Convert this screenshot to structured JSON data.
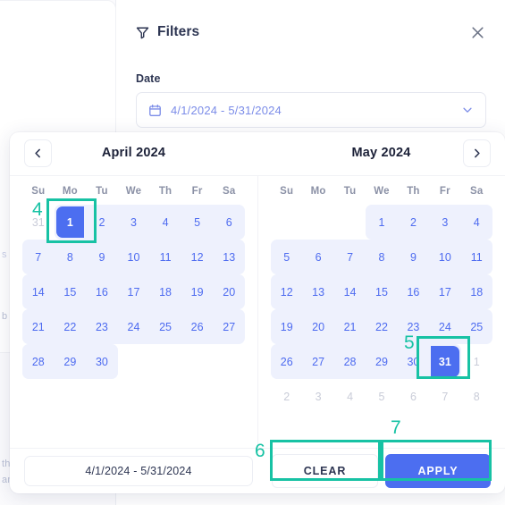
{
  "background": {
    "fragments": [
      "s",
      "b",
      "th",
      "an"
    ]
  },
  "filters": {
    "title": "Filters",
    "filter_icon": "funnel-icon",
    "close_icon": "close-icon"
  },
  "date_field": {
    "label": "Date",
    "value": "4/1/2024 - 5/31/2024",
    "calendar_icon": "calendar-icon",
    "chevron_icon": "chevron-down-icon"
  },
  "calendar": {
    "prev_icon": "chevron-left-icon",
    "next_icon": "chevron-right-icon",
    "weekdays": [
      "Su",
      "Mo",
      "Tu",
      "We",
      "Th",
      "Fr",
      "Sa"
    ],
    "months": [
      {
        "title": "April 2024",
        "weeks": [
          [
            {
              "d": "31",
              "state": "muted"
            },
            {
              "d": "1",
              "state": "selected-start"
            },
            {
              "d": "2",
              "state": "in-range"
            },
            {
              "d": "3",
              "state": "in-range"
            },
            {
              "d": "4",
              "state": "in-range"
            },
            {
              "d": "5",
              "state": "in-range"
            },
            {
              "d": "6",
              "state": "in-range-end"
            }
          ],
          [
            {
              "d": "7",
              "state": "in-range-start"
            },
            {
              "d": "8",
              "state": "in-range"
            },
            {
              "d": "9",
              "state": "in-range"
            },
            {
              "d": "10",
              "state": "in-range"
            },
            {
              "d": "11",
              "state": "in-range"
            },
            {
              "d": "12",
              "state": "in-range"
            },
            {
              "d": "13",
              "state": "in-range-end"
            }
          ],
          [
            {
              "d": "14",
              "state": "in-range-start"
            },
            {
              "d": "15",
              "state": "in-range"
            },
            {
              "d": "16",
              "state": "in-range"
            },
            {
              "d": "17",
              "state": "in-range"
            },
            {
              "d": "18",
              "state": "in-range"
            },
            {
              "d": "19",
              "state": "in-range"
            },
            {
              "d": "20",
              "state": "in-range-end"
            }
          ],
          [
            {
              "d": "21",
              "state": "in-range-start"
            },
            {
              "d": "22",
              "state": "in-range"
            },
            {
              "d": "23",
              "state": "in-range"
            },
            {
              "d": "24",
              "state": "in-range"
            },
            {
              "d": "25",
              "state": "in-range"
            },
            {
              "d": "26",
              "state": "in-range"
            },
            {
              "d": "27",
              "state": "in-range-end"
            }
          ],
          [
            {
              "d": "28",
              "state": "in-range-start"
            },
            {
              "d": "29",
              "state": "in-range"
            },
            {
              "d": "30",
              "state": "in-range-end"
            },
            {
              "d": "",
              "state": "empty"
            },
            {
              "d": "",
              "state": "empty"
            },
            {
              "d": "",
              "state": "empty"
            },
            {
              "d": "",
              "state": "empty"
            }
          ],
          [
            {
              "d": "",
              "state": "empty"
            },
            {
              "d": "",
              "state": "empty"
            },
            {
              "d": "",
              "state": "empty"
            },
            {
              "d": "",
              "state": "empty"
            },
            {
              "d": "",
              "state": "empty"
            },
            {
              "d": "",
              "state": "empty"
            },
            {
              "d": "",
              "state": "empty"
            }
          ]
        ]
      },
      {
        "title": "May 2024",
        "weeks": [
          [
            {
              "d": "",
              "state": "empty"
            },
            {
              "d": "",
              "state": "empty"
            },
            {
              "d": "",
              "state": "empty"
            },
            {
              "d": "1",
              "state": "in-range-start"
            },
            {
              "d": "2",
              "state": "in-range"
            },
            {
              "d": "3",
              "state": "in-range"
            },
            {
              "d": "4",
              "state": "in-range-end"
            }
          ],
          [
            {
              "d": "5",
              "state": "in-range-start"
            },
            {
              "d": "6",
              "state": "in-range"
            },
            {
              "d": "7",
              "state": "in-range"
            },
            {
              "d": "8",
              "state": "in-range"
            },
            {
              "d": "9",
              "state": "in-range"
            },
            {
              "d": "10",
              "state": "in-range"
            },
            {
              "d": "11",
              "state": "in-range-end"
            }
          ],
          [
            {
              "d": "12",
              "state": "in-range-start"
            },
            {
              "d": "13",
              "state": "in-range"
            },
            {
              "d": "14",
              "state": "in-range"
            },
            {
              "d": "15",
              "state": "in-range"
            },
            {
              "d": "16",
              "state": "in-range"
            },
            {
              "d": "17",
              "state": "in-range"
            },
            {
              "d": "18",
              "state": "in-range-end"
            }
          ],
          [
            {
              "d": "19",
              "state": "in-range-start"
            },
            {
              "d": "20",
              "state": "in-range"
            },
            {
              "d": "21",
              "state": "in-range"
            },
            {
              "d": "22",
              "state": "in-range"
            },
            {
              "d": "23",
              "state": "in-range"
            },
            {
              "d": "24",
              "state": "in-range"
            },
            {
              "d": "25",
              "state": "in-range-end"
            }
          ],
          [
            {
              "d": "26",
              "state": "in-range-start"
            },
            {
              "d": "27",
              "state": "in-range"
            },
            {
              "d": "28",
              "state": "in-range"
            },
            {
              "d": "29",
              "state": "in-range"
            },
            {
              "d": "30",
              "state": "in-range"
            },
            {
              "d": "31",
              "state": "selected-end"
            },
            {
              "d": "1",
              "state": "muted"
            }
          ],
          [
            {
              "d": "2",
              "state": "muted"
            },
            {
              "d": "3",
              "state": "muted"
            },
            {
              "d": "4",
              "state": "muted"
            },
            {
              "d": "5",
              "state": "muted"
            },
            {
              "d": "6",
              "state": "muted"
            },
            {
              "d": "7",
              "state": "muted"
            },
            {
              "d": "8",
              "state": "muted"
            }
          ]
        ]
      }
    ],
    "footer": {
      "range_value": "4/1/2024 - 5/31/2024",
      "clear_label": "CLEAR",
      "apply_label": "APPLY"
    }
  },
  "annotations": {
    "accent_color": "#17c2a4",
    "items": [
      {
        "num": "4",
        "target": "april-1-cell"
      },
      {
        "num": "5",
        "target": "may-31-cell"
      },
      {
        "num": "6",
        "target": "clear-button"
      },
      {
        "num": "7",
        "target": "apply-button"
      }
    ]
  }
}
